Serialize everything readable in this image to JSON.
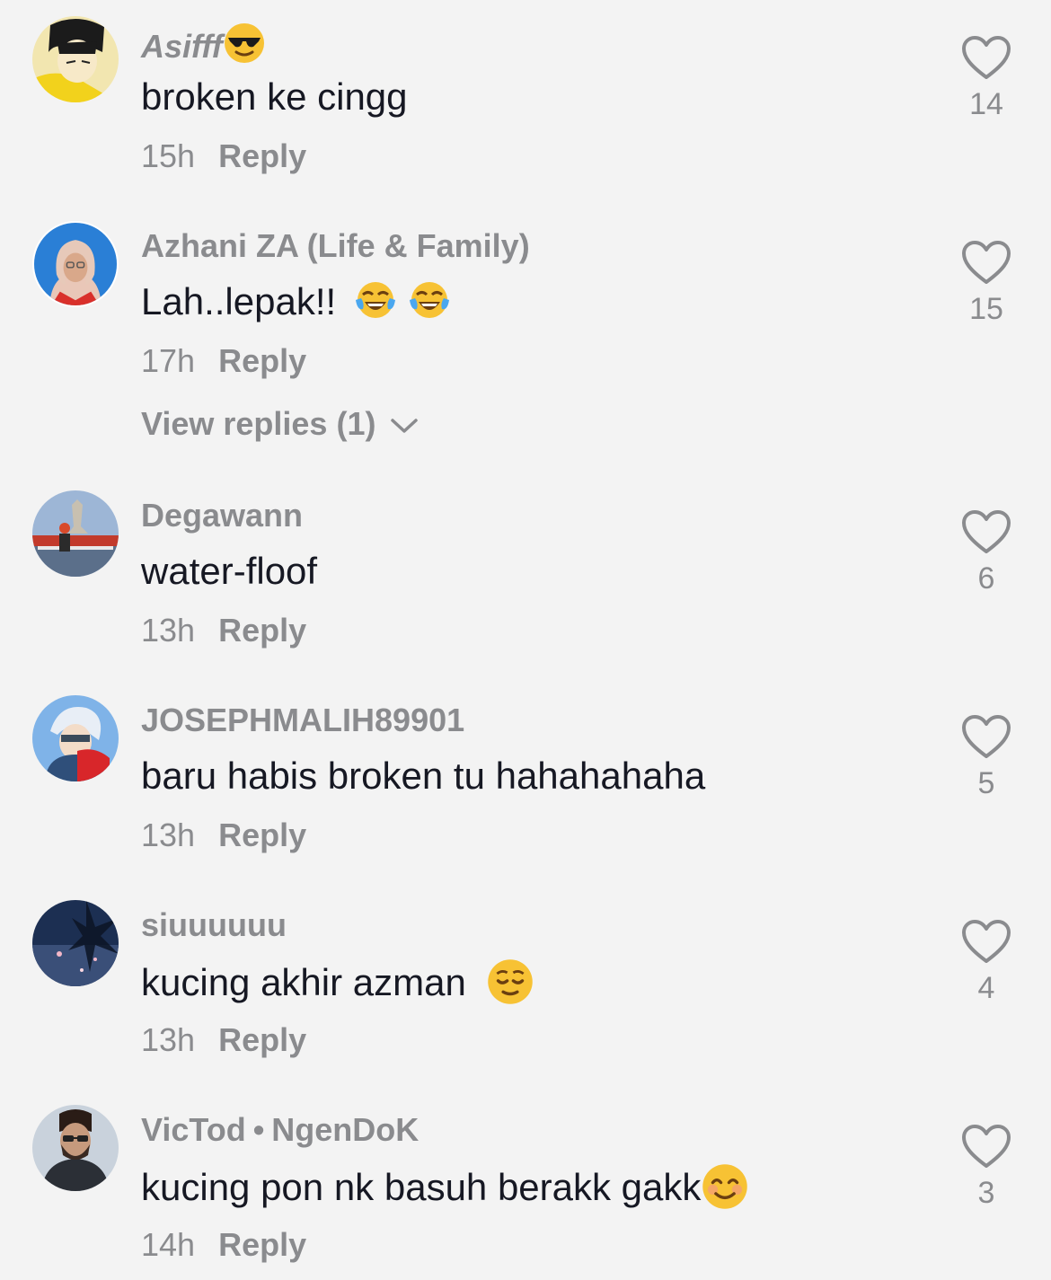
{
  "colors": {
    "background": "#f3f3f3",
    "username": "#8a8b8e",
    "text": "#161823",
    "meta": "#8a8b8e",
    "emoji_yellow": "#f7c234"
  },
  "comments": [
    {
      "username": "Asifff",
      "username_emoji": "sunglasses-emoji",
      "text": "broken ke cingg",
      "time": "15h",
      "reply_label": "Reply",
      "likes": "14"
    },
    {
      "username": "Azhani ZA (Life & Family)",
      "text": "Lah..lepak!!",
      "text_emojis": [
        "tears-of-joy-emoji",
        "tears-of-joy-emoji"
      ],
      "time": "17h",
      "reply_label": "Reply",
      "likes": "15",
      "view_replies": "View replies (1)"
    },
    {
      "username": "Degawann",
      "text": "water-floof",
      "time": "13h",
      "reply_label": "Reply",
      "likes": "6"
    },
    {
      "username": "JOSEPHMALIH89901",
      "text": "baru habis broken tu hahahahaha",
      "time": "13h",
      "reply_label": "Reply",
      "likes": "5"
    },
    {
      "username": "siuuuuuu",
      "text": "kucing akhir azman",
      "text_emojis": [
        "relieved-emoji"
      ],
      "time": "13h",
      "reply_label": "Reply",
      "likes": "4"
    },
    {
      "username": "VicTod",
      "username_separator": "•",
      "username_suffix": "NgenDoK",
      "text": "kucing pon nk basuh berakk gakk",
      "text_emojis": [
        "smiling-emoji"
      ],
      "time": "14h",
      "reply_label": "Reply",
      "likes": "3"
    }
  ]
}
